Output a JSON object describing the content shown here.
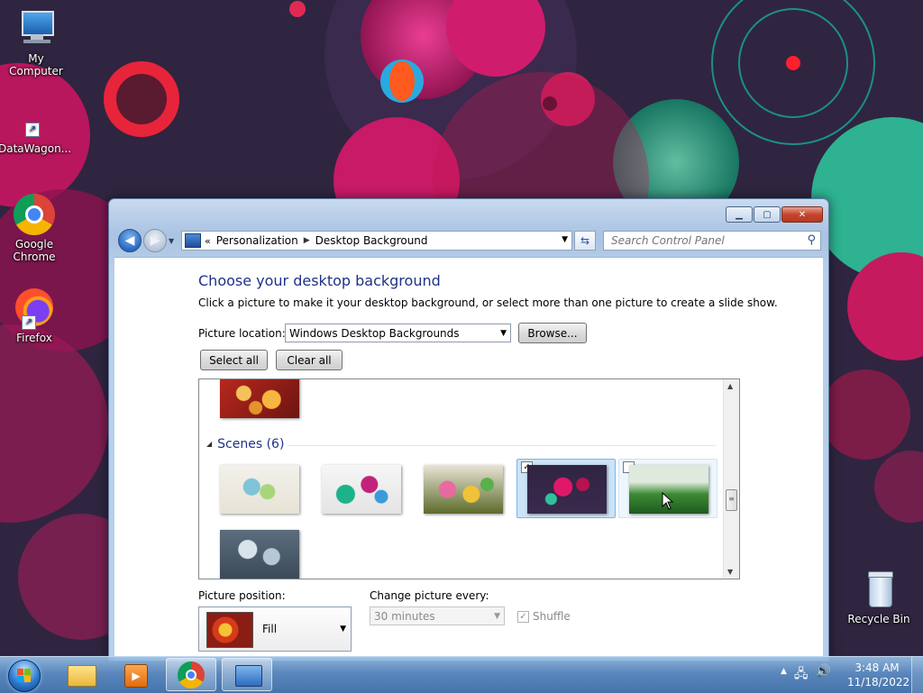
{
  "desktop": {
    "icons": [
      {
        "label": "My Computer",
        "icon": "computer-icon"
      },
      {
        "label": "DataWagon...",
        "icon": "shortcut-icon"
      },
      {
        "label": "Google Chrome",
        "icon": "chrome-icon"
      },
      {
        "label": "Firefox",
        "icon": "firefox-icon"
      },
      {
        "label": "Recycle Bin",
        "icon": "recycle-bin-icon"
      }
    ]
  },
  "window": {
    "address": {
      "crumbs": [
        "Personalization",
        "Desktop Background"
      ]
    },
    "search": {
      "placeholder": "Search Control Panel"
    },
    "title": "Choose your desktop background",
    "subtitle": "Click a picture to make it your desktop background, or select more than one picture to create a slide show.",
    "picture_location": {
      "label": "Picture location:",
      "value": "Windows Desktop Backgrounds",
      "browse_label": "Browse..."
    },
    "select_all_label": "Select all",
    "clear_all_label": "Clear all",
    "gallery": {
      "group_name": "Scenes",
      "group_count": "(6)",
      "scenes": [
        {
          "checked": false,
          "selected": false
        },
        {
          "checked": false,
          "selected": false
        },
        {
          "checked": false,
          "selected": false
        },
        {
          "checked": true,
          "selected": true
        },
        {
          "checked": false,
          "selected": false
        },
        {
          "checked": false,
          "selected": false
        }
      ]
    },
    "picture_position": {
      "label": "Picture position:",
      "value": "Fill"
    },
    "change_every": {
      "label": "Change picture every:",
      "value": "30 minutes"
    },
    "shuffle": {
      "label": "Shuffle",
      "checked": true
    }
  },
  "taskbar": {
    "clock_time": "3:48 AM",
    "clock_date": "11/18/2022",
    "tray_overflow": "▲",
    "colors": {
      "accent": "#1e3287",
      "selection": "#cce4f7"
    }
  }
}
